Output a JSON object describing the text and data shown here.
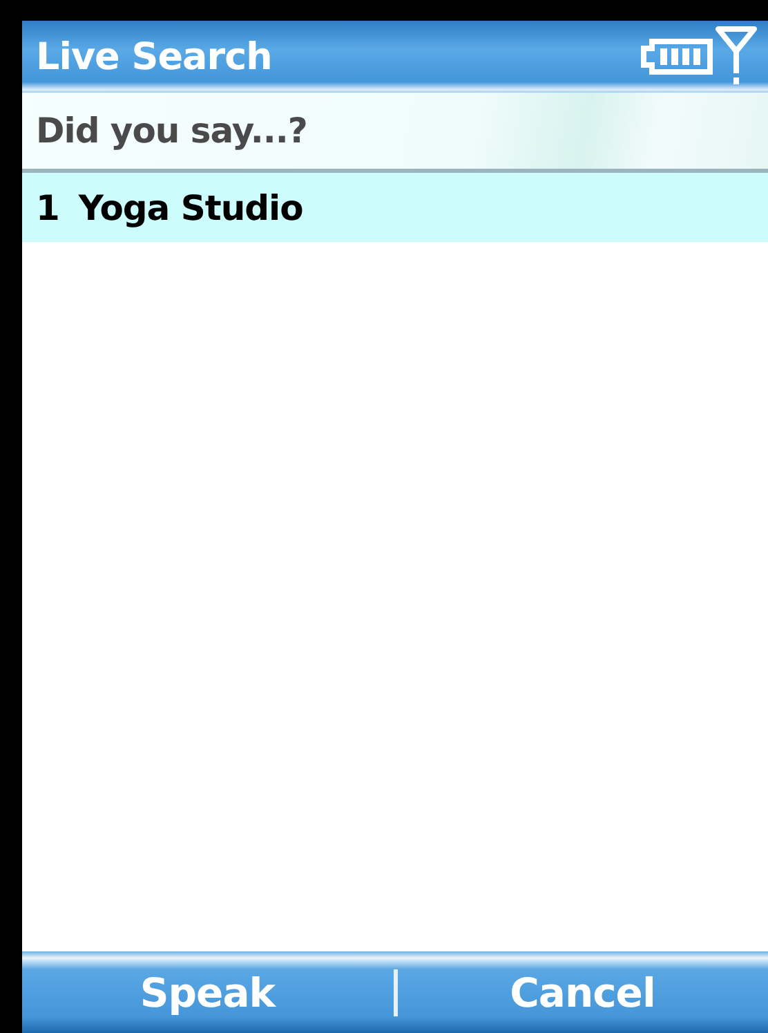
{
  "title_bar": {
    "title": "Live Search"
  },
  "header": "Did you say...?",
  "results": [
    {
      "number": "1",
      "label": "Yoga Studio",
      "selected": true
    }
  ],
  "softkeys": [
    "Speak",
    "Cancel"
  ]
}
